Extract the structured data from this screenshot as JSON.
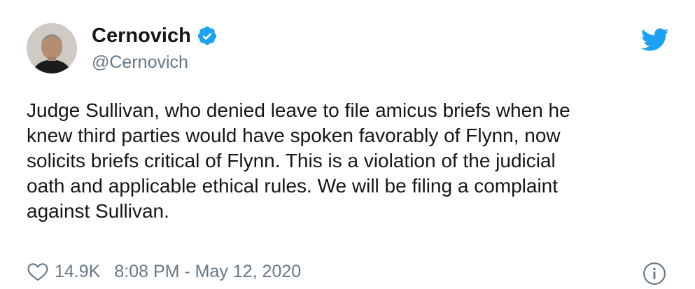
{
  "tweet": {
    "author": {
      "display_name": "Cernovich",
      "handle": "@Cernovich",
      "verified": true
    },
    "text": "Judge Sullivan, who denied leave to file amicus briefs when he\nknew third parties would have spoken favorably of Flynn, now\nsolicits briefs critical of Flynn. This is a violation of the judicial\noath and applicable ethical rules. We will be filing a complaint\nagainst Sullivan.",
    "likes": "14.9K",
    "timestamp": "8:08 PM - May 12, 2020"
  },
  "icons": {
    "verified": "verified-badge-icon",
    "brand": "twitter-bird-icon",
    "like": "heart-icon",
    "info": "info-icon"
  },
  "colors": {
    "brand_blue": "#1da1f2",
    "text_primary": "#14171a",
    "text_secondary": "#657786"
  }
}
